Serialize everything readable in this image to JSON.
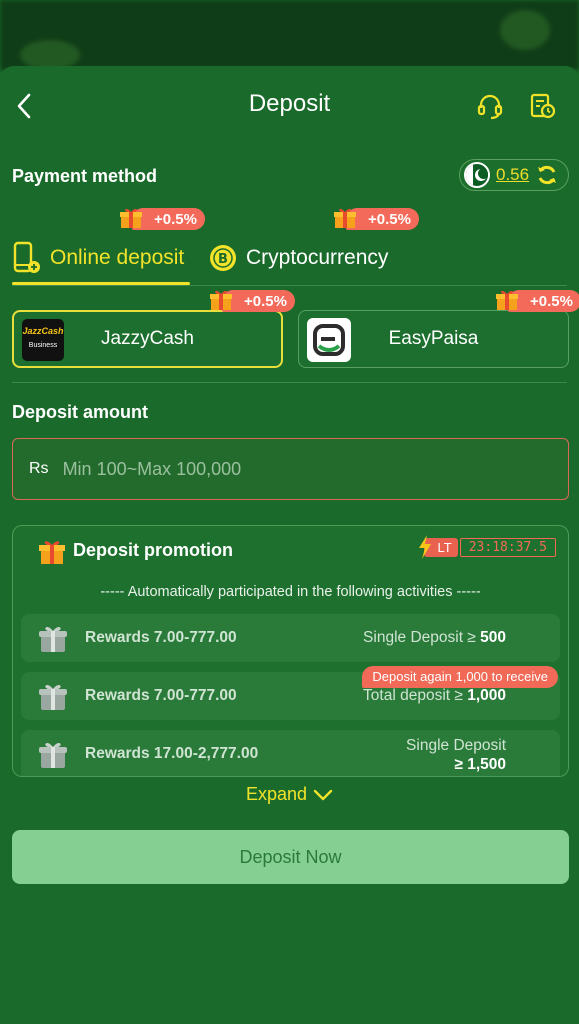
{
  "header": {
    "title": "Deposit"
  },
  "payment": {
    "label": "Payment method",
    "balance": "0.56",
    "tabs": [
      {
        "label": "Online deposit",
        "bonus": "+0.5%"
      },
      {
        "label": "Cryptocurrency",
        "bonus": "+0.5%"
      }
    ],
    "methods": [
      {
        "label": "JazzyCash",
        "bonus": "+0.5%",
        "logo_text": "JazzCash",
        "logo_sub": "Business"
      },
      {
        "label": "EasyPaisa",
        "bonus": "+0.5%"
      }
    ]
  },
  "amount": {
    "label": "Deposit amount",
    "currency": "Rs",
    "placeholder": "Min 100~Max 100,000"
  },
  "promotion": {
    "title": "Deposit promotion",
    "badge": "LT",
    "timer": "23:18:37.5",
    "subtitle": "----- Automatically participated in the following activities -----",
    "rewards": [
      {
        "label": "Rewards 7.00-777.00",
        "cond_text": "Single Deposit ≥ ",
        "cond_value": "500"
      },
      {
        "label": "Rewards 7.00-777.00",
        "cond_text": "Total deposit ≥ ",
        "cond_value": "1,000"
      },
      {
        "label": "Rewards 17.00-2,777.00",
        "cond_text": "Single Deposit",
        "cond_value": "≥ 1,500"
      }
    ],
    "again_notice": "Deposit again 1,000 to receive",
    "expand_label": "Expand"
  },
  "deposit_button": "Deposit Now",
  "colors": {
    "accent": "#f2e32a",
    "bonus": "#f46a5a",
    "background": "#1a6b2b",
    "button": "#86cf93"
  }
}
